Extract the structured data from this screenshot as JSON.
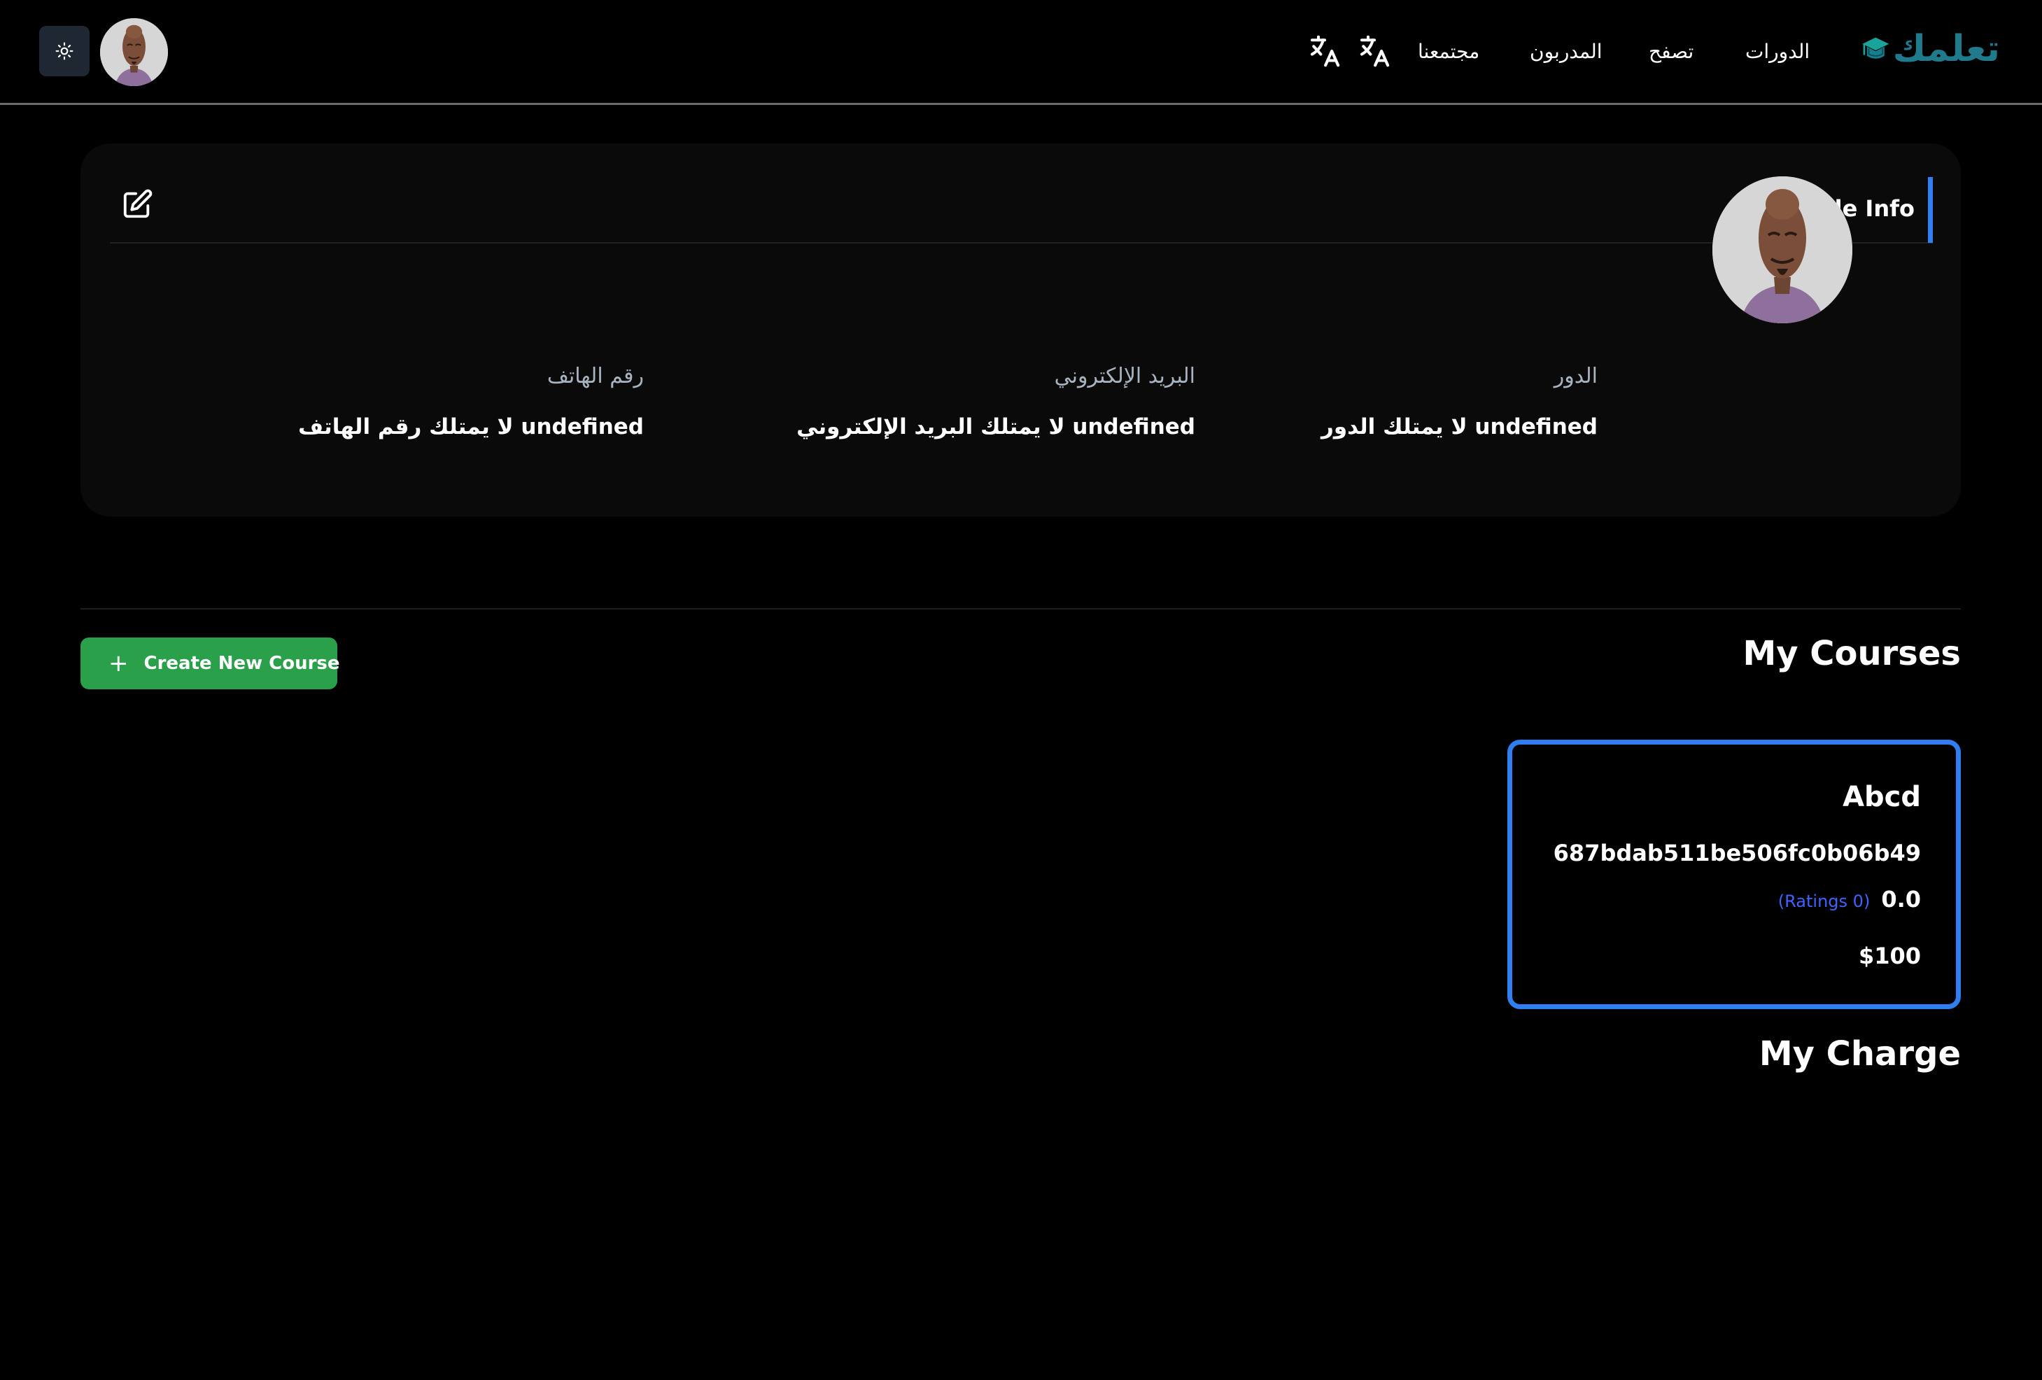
{
  "header": {
    "logo_text": "تعلمك",
    "nav": {
      "courses": "الدورات",
      "browse": "تصفح",
      "trainers": "المدربون",
      "community": "مجتمعنا"
    },
    "icons": {
      "theme": "sun-icon",
      "language": "translate-icon",
      "logo": "graduation-cap-icon"
    }
  },
  "profile": {
    "title": "Profile Info",
    "fields": {
      "role": {
        "label": "الدور",
        "value": "undefined لا يمتلك الدور"
      },
      "email": {
        "label": "البريد الإلكتروني",
        "value": "undefined لا يمتلك البريد الإلكتروني"
      },
      "phone": {
        "label": "رقم الهاتف",
        "value": "undefined لا يمتلك رقم الهاتف"
      }
    }
  },
  "courses_section": {
    "title": "My Courses",
    "create_button_label": "Create New Course",
    "courses": [
      {
        "title": "Abcd",
        "id": "687bdab511be506fc0b06b49",
        "ratings_count": "(Ratings 0)",
        "rating": "0.0",
        "price": "$100"
      }
    ]
  },
  "charge_section": {
    "title": "My Charge"
  },
  "colors": {
    "accent_blue": "#2f7ff0",
    "create_green": "#2aa04a",
    "logo_teal": "#1f7a8c",
    "ratings_blue": "#3f63ff"
  }
}
